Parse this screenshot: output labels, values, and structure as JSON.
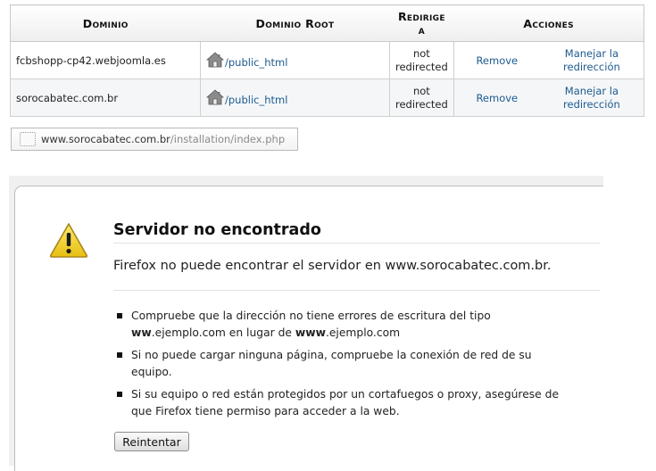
{
  "table": {
    "headers": {
      "domain": "Dominio",
      "root": "Dominio Root",
      "redirect": "Redirige a",
      "actions": "Acciones"
    },
    "rows": [
      {
        "domain": "fcbshopp-cp42.webjoomla.es",
        "root": "/public_html",
        "redirect": "not redirected",
        "remove": "Remove",
        "manage": "Manejar la redirección"
      },
      {
        "domain": "sorocabatec.com.br",
        "root": "/public_html",
        "redirect": "not redirected",
        "remove": "Remove",
        "manage": "Manejar la redirección"
      }
    ]
  },
  "address_bar": {
    "host": "www.sorocabatec.com.br",
    "path": "/installation/index.php"
  },
  "error_page": {
    "icon": "warning-triangle-icon",
    "title": "Servidor no encontrado",
    "description": "Firefox no puede encontrar el servidor en www.sorocabatec.com.br.",
    "tip1_before": "Compruebe que la dirección no tiene errores de escritura del tipo",
    "tip1_bold1": "ww",
    "tip1_mid": ".ejemplo.com en lugar de",
    "tip1_bold2": "www",
    "tip1_after": ".ejemplo.com",
    "tip2": "Si no puede cargar ninguna página, compruebe la conexión de red de su equipo.",
    "tip3": "Si su equipo o red están protegidos por un cortafuegos o proxy, asegúrese de que Firefox tiene permiso para acceder a la web.",
    "retry_label": "Reintentar"
  },
  "colors": {
    "link": "#1d5b8f",
    "row_alt": "#f4f6f8",
    "warning_yellow": "#f2d431"
  }
}
